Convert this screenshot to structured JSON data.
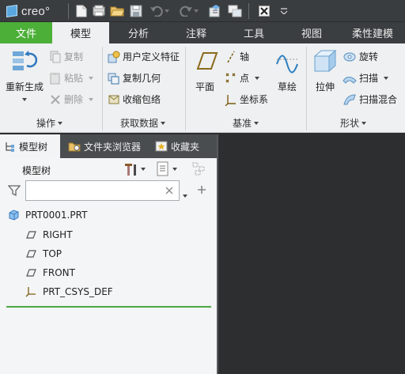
{
  "app": {
    "logo_text": "creo°"
  },
  "quick_access": [
    {
      "icon": "new-file-icon"
    },
    {
      "icon": "open-icon"
    },
    {
      "icon": "open-folder-icon"
    },
    {
      "icon": "save-icon"
    },
    {
      "icon": "undo-icon"
    },
    {
      "icon": "redo-icon"
    },
    {
      "icon": "regenerate-icon"
    },
    {
      "icon": "windows-icon"
    },
    {
      "icon": "close-window-icon"
    },
    {
      "icon": "customize-dropdown-icon"
    }
  ],
  "tabs": [
    {
      "label": "文件"
    },
    {
      "label": "模型"
    },
    {
      "label": "分析"
    },
    {
      "label": "注释"
    },
    {
      "label": "工具"
    },
    {
      "label": "视图"
    },
    {
      "label": "柔性建模"
    }
  ],
  "ribbon": {
    "operations": {
      "regenerate": "重新生成",
      "copy": "复制",
      "paste": "粘贴",
      "delete": "删除",
      "group_label": "操作"
    },
    "get_data": {
      "udf": "用户定义特征",
      "copy_geom": "复制几何",
      "shrinkwrap": "收缩包络",
      "group_label": "获取数据"
    },
    "datum": {
      "plane": "平面",
      "axis": "轴",
      "point": "点",
      "csys": "坐标系",
      "sketch": "草绘",
      "group_label": "基准"
    },
    "shapes": {
      "extrude": "拉伸",
      "revolve": "旋转",
      "sweep": "扫描",
      "swept_blend": "扫描混合",
      "group_label": "形状"
    }
  },
  "panel_tabs": [
    {
      "label": "模型树"
    },
    {
      "label": "文件夹浏览器"
    },
    {
      "label": "收藏夹"
    }
  ],
  "model_tree": {
    "title": "模型树",
    "search_value": "",
    "items": [
      {
        "label": "PRT0001.PRT",
        "icon": "part-icon"
      },
      {
        "label": "RIGHT",
        "icon": "datum-plane-icon"
      },
      {
        "label": "TOP",
        "icon": "datum-plane-icon"
      },
      {
        "label": "FRONT",
        "icon": "datum-plane-icon"
      },
      {
        "label": "PRT_CSYS_DEF",
        "icon": "csys-icon"
      }
    ]
  },
  "colors": {
    "file_tab": "#4caf38",
    "ribbon_bg": "#eef0f1",
    "graphics_bg": "#2c2e30",
    "insert_line": "#49a942"
  }
}
